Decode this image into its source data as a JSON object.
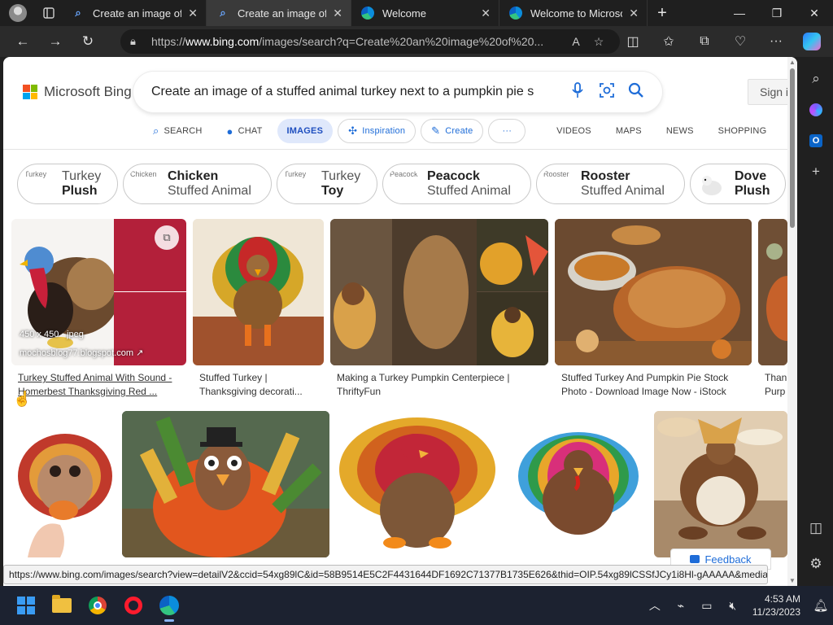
{
  "browser": {
    "tabs": [
      {
        "title": "Create an image of a stuffed animal turkey",
        "icon": "search-icon"
      },
      {
        "title": "Create an image of a stuffed animal turkey",
        "icon": "search-icon"
      },
      {
        "title": "Welcome",
        "icon": "edge-icon"
      },
      {
        "title": "Welcome to Microsoft Edge",
        "icon": "edge-icon"
      }
    ],
    "url_prefix": "https://",
    "url_domain": "www.bing.com",
    "url_rest": "/images/search?q=Create%20an%20image%20of%20..."
  },
  "bing": {
    "logo_text": "Microsoft Bing",
    "query": "Create an image of a stuffed animal turkey next to a pumpkin pie s",
    "sign_in": "Sign in",
    "scopes": [
      {
        "label": "SEARCH",
        "icon": "search-icon"
      },
      {
        "label": "CHAT",
        "icon": "chat-icon"
      },
      {
        "label": "IMAGES"
      },
      {
        "label": "Inspiration",
        "icon": "inspiration-icon"
      },
      {
        "label": "Create",
        "icon": "create-icon"
      },
      {
        "label": "···"
      },
      {
        "label": "VIDEOS"
      },
      {
        "label": "MAPS"
      },
      {
        "label": "NEWS"
      },
      {
        "label": "SHOPPING"
      }
    ],
    "chips": [
      {
        "alt": "Turkey",
        "a": "Turkey",
        "b": "Plush",
        "bold": "b"
      },
      {
        "alt": "Chicken",
        "a": "Chicken",
        "b": "Stuffed Animal",
        "bold": "a"
      },
      {
        "alt": "Turkey",
        "a": "Turkey",
        "b": "Toy",
        "bold": "b"
      },
      {
        "alt": "Peacock",
        "a": "Peacock",
        "b": "Stuffed Animal",
        "bold": "a"
      },
      {
        "alt": "Rooster",
        "a": "Rooster",
        "b": "Stuffed Animal",
        "bold": "a"
      },
      {
        "alt": "",
        "a": "Dove",
        "b": "Plush",
        "bold": "both"
      }
    ],
    "results_row1": [
      {
        "caption_1": "Turkey Stuffed Animal With Sound -",
        "caption_2": "Homerbest Thanksgiving Red ...",
        "size": "450 x 450 · jpeg",
        "source": "mochosblog77.blogspot.com"
      },
      {
        "caption_1": "Stuffed Turkey |",
        "caption_2": "Thanksgiving decorati..."
      },
      {
        "caption_1": "Making a Turkey Pumpkin Centerpiece |",
        "caption_2": "ThriftyFun"
      },
      {
        "caption_1": "Stuffed Turkey And Pumpkin Pie Stock",
        "caption_2": "Photo - Download Image Now - iStock"
      },
      {
        "caption_1": "Thank",
        "caption_2": "Purp"
      }
    ],
    "feedback": "Feedback",
    "status_url": "https://www.bing.com/images/search?view=detailV2&ccid=54xg89lC&id=58B9514E5C2F4431644DF1692C71377B1735E626&thid=OIP.54xg89lCSSfJCy1i8Hl-gAAAAA&media..."
  },
  "taskbar": {
    "time": "4:53 AM",
    "date": "11/23/2023"
  },
  "colors": {
    "accent": "#1f6dd8",
    "taskbar": "#1c2230",
    "chrome_dark": "#1f1f1f"
  }
}
